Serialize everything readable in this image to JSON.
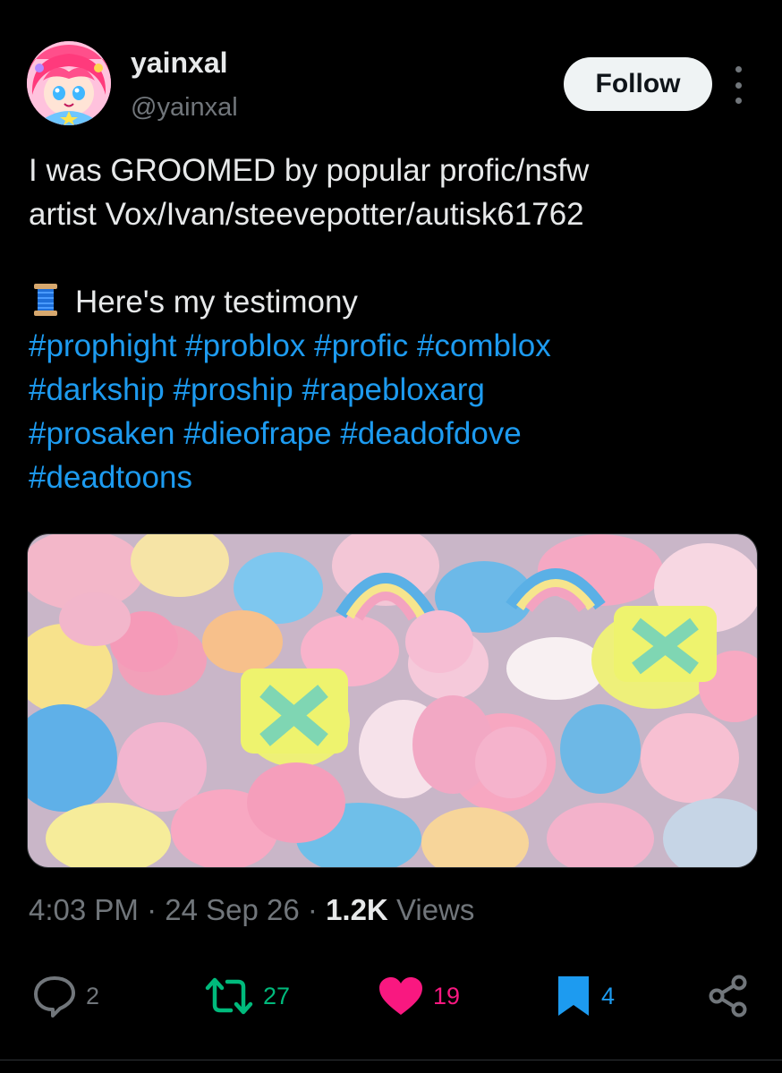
{
  "author": {
    "display_name": "yainxal",
    "handle": "@yainxal",
    "avatar_icon": "anime-avatar-icon"
  },
  "header": {
    "follow_label": "Follow",
    "more_icon": "more-vertical-icon"
  },
  "tweet": {
    "line1": "I was GROOMED by popular profic/nsfw",
    "line2": "artist Vox/Ivan/steevepotter/autisk61762",
    "testimony_icon": "spool-of-thread-icon",
    "testimony_text": "Here's my testimony",
    "hashtags": [
      "#prophight",
      "#problox",
      "#profic",
      "#comblox",
      "#darkship",
      "#proship",
      "#rapebloxarg",
      "#prosaken",
      "#dieofrape",
      "#deadofdove",
      "#deadtoons"
    ]
  },
  "media": {
    "icon": "marshmallow-cereal-photo"
  },
  "meta": {
    "time": "4:03 PM",
    "separator": "·",
    "date": "24 Sep 26",
    "views_count": "1.2K",
    "views_label": "Views"
  },
  "actions": {
    "reply": {
      "icon": "reply-icon",
      "count": "2",
      "color": "#71767b"
    },
    "repost": {
      "icon": "repost-icon",
      "count": "27",
      "color": "#00ba7c"
    },
    "like": {
      "icon": "heart-filled-icon",
      "count": "19",
      "color": "#f91880"
    },
    "bookmark": {
      "icon": "bookmark-filled-icon",
      "count": "4",
      "color": "#1d9bf0"
    },
    "share": {
      "icon": "share-icon",
      "color": "#71767b"
    }
  },
  "colors": {
    "background": "#000000",
    "text": "#e7e9ea",
    "muted": "#71767b",
    "link": "#1d9bf0"
  }
}
